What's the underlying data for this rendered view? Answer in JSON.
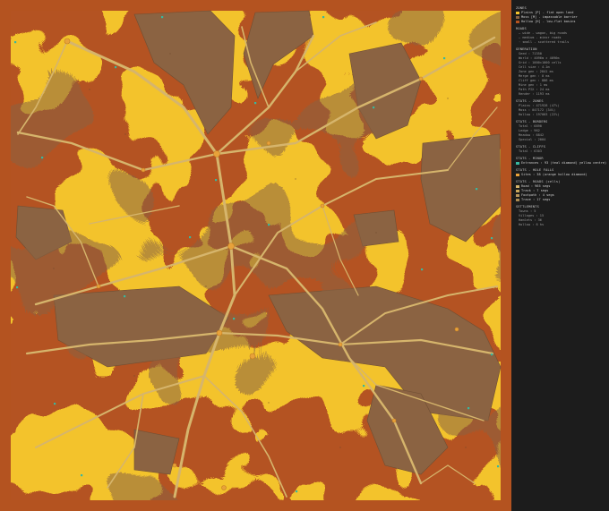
{
  "colors": {
    "plains": "#f3c32c",
    "moss": "#8b6342",
    "hollow": "#b45320",
    "road": "#d6b56c",
    "settlement": "#e8a23a",
    "dot": "#37b8a0",
    "panel_bg": "#1c1c1c"
  },
  "legend": {
    "zones_title": "ZONES",
    "zones": [
      {
        "swatch": "#f3c32c",
        "text": "Plains [P] - flat open land"
      },
      {
        "swatch": "#8b6342",
        "text": "Moss [M] - impassable barrier"
      },
      {
        "swatch": "#b45320",
        "text": "Hollow [H] - low-flat basins"
      }
    ],
    "roads_title": "ROADS",
    "roads": [
      "— wide - wagon, big roads",
      "— medium - minor roads",
      "· small - scattered trails"
    ],
    "generation_title": "GENERATION",
    "generation": [
      "Seed : 71350",
      "World : 4096m × 4096m",
      "Grid : 1000×1000 cells",
      "Cell size : 4.1m",
      "Zone gen : 2841 ms",
      "Merge gen : 0 ms",
      "Cliff gen : 886 ms",
      "Mine gen : 1 ms",
      "Path PIX : 24 ms",
      "Render : 1193 ms"
    ],
    "stats_zones_title": "STATS - ZONES",
    "stats_zones": [
      "Plains : 471928 (47%)",
      "Moss : 047172 (34%)",
      "Hollow : 197003 (22%)"
    ],
    "stats_borders_title": "STATS - BORDERS",
    "stats_borders": [
      "Total : 6890",
      "Ledge : 962",
      "Meadow : 6842",
      "Special : 2004"
    ],
    "stats_cliffs_title": "STATS - CLIFFS",
    "stats_cliffs": [
      "Total : 6303"
    ],
    "stats_minor_title": "STATS - MINOR",
    "stats_minor": [
      {
        "swatch": "#37b8a0",
        "text": "Entrances : 93 (teal diamond) yellow centre)"
      }
    ],
    "stats_hole_title": "STATS - HOLE FALLS",
    "stats_hole": [
      {
        "swatch": "#e8a23a",
        "text": "Sites : 38 (orange hollow diamond)"
      }
    ],
    "stats_roads_title": "STATS - ROADS (cells)",
    "stats_roads": [
      {
        "swatch": "#d6b56c",
        "text": "Road : 965 segs"
      },
      {
        "swatch": "#c9a65a",
        "text": "Track : 7 segs"
      },
      {
        "swatch": "#b9975a",
        "text": "Footpath : 4 segs"
      },
      {
        "swatch": "#a88a52",
        "text": "Trace : 17 segs"
      }
    ],
    "settlements_title": "SETTLEMENTS",
    "settlements": [
      "Towns : 5",
      "Villages : 15",
      "Hamlets : 36",
      "Hollow : 6 hs"
    ]
  }
}
